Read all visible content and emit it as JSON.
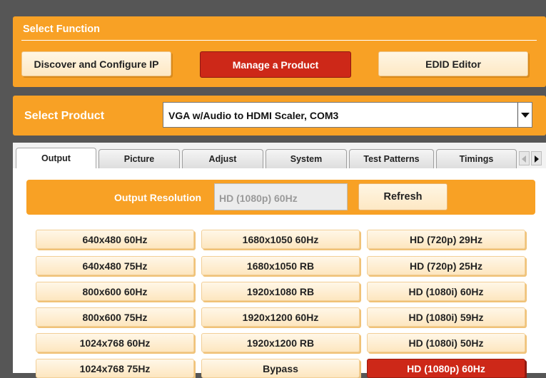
{
  "select_function": {
    "title": "Select Function",
    "buttons": [
      {
        "label": "Discover and Configure IP"
      },
      {
        "label": "Manage a Product"
      },
      {
        "label": "EDID Editor"
      }
    ]
  },
  "select_product": {
    "label": "Select Product",
    "selected": "VGA w/Audio to HDMI Scaler, COM3"
  },
  "tabs": [
    "Output",
    "Picture",
    "Adjust",
    "System",
    "Test Patterns",
    "Timings"
  ],
  "active_tab": "Output",
  "output": {
    "resolution_label": "Output Resolution",
    "resolution_value": "HD (1080p) 60Hz",
    "refresh_label": "Refresh"
  },
  "resolutions": {
    "col1": [
      "640x480 60Hz",
      "640x480 75Hz",
      "800x600 60Hz",
      "800x600 75Hz",
      "1024x768 60Hz",
      "1024x768 75Hz"
    ],
    "col2": [
      "1680x1050 60Hz",
      "1680x1050 RB",
      "1920x1080 RB",
      "1920x1200 60Hz",
      "1920x1200 RB",
      "Bypass"
    ],
    "col3": [
      "HD (720p) 29Hz",
      "HD (720p) 25Hz",
      "HD (1080i) 60Hz",
      "HD (1080i) 59Hz",
      "HD (1080i) 50Hz",
      "HD (1080p) 60Hz"
    ],
    "selected": "HD (1080p) 60Hz"
  },
  "colors": {
    "accent_orange": "#f8a125",
    "selected_red": "#cd2818",
    "background": "#565656"
  }
}
